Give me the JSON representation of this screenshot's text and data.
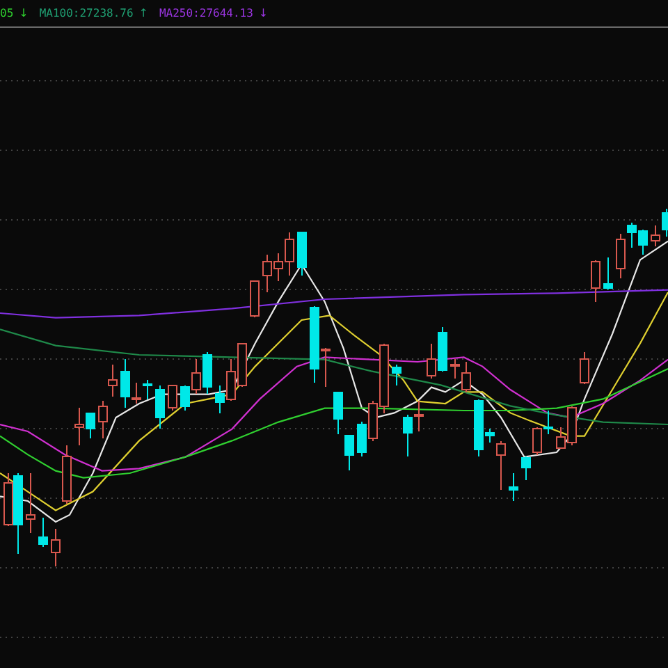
{
  "legend": [
    {
      "label": "05",
      "arrow": "↓",
      "color": "#2fd02f"
    },
    {
      "label": "MA100:27238.76",
      "arrow": "↑",
      "color": "#1f9f72"
    },
    {
      "label": "MA250:27644.13",
      "arrow": "↓",
      "color": "#9a35e0"
    }
  ]
}
